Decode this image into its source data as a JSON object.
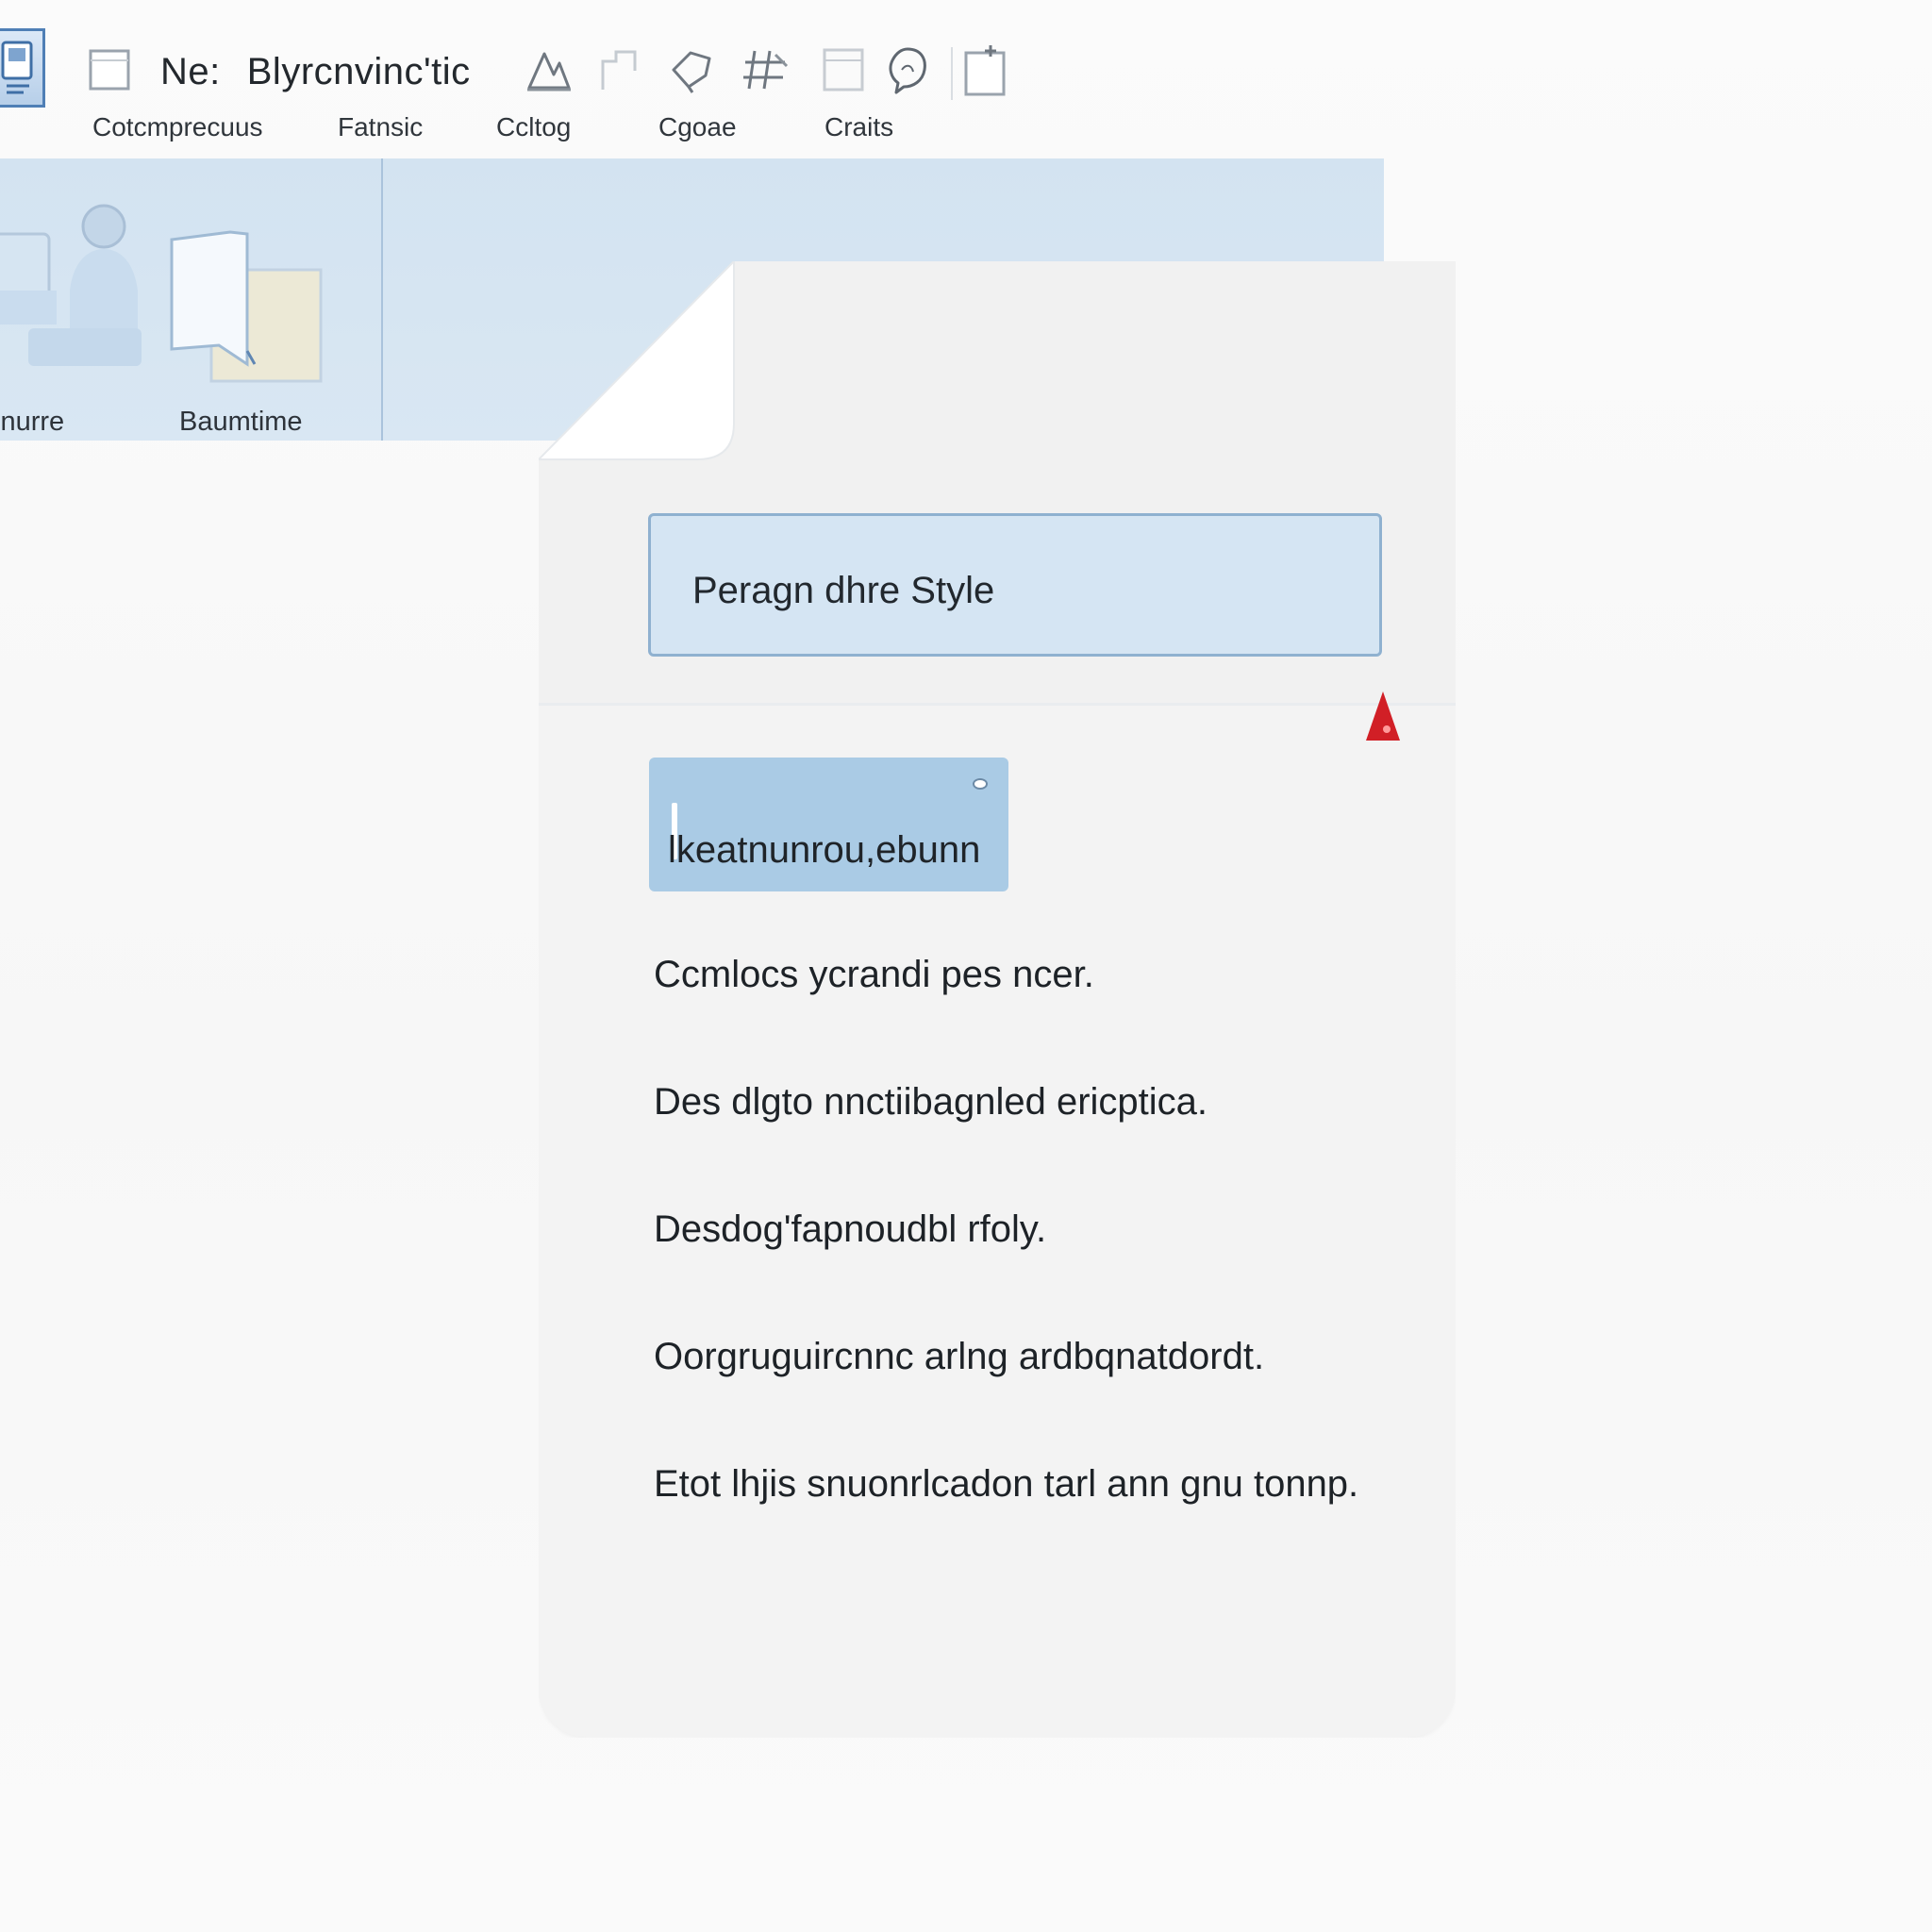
{
  "toolbar": {
    "title_prefix": "Ne:",
    "title": "Blyrcnvinc'tic",
    "icons": [
      "app-icon",
      "page-icon",
      "drawing-tool-icon",
      "shape-icon",
      "lasso-icon",
      "hashtag-icon",
      "table-icon",
      "speech-icon",
      "new-page-icon"
    ]
  },
  "tabs": [
    {
      "label": "Cotcmprecuus"
    },
    {
      "label": "Fatnsic"
    },
    {
      "label": "Ccltog"
    },
    {
      "label": "Cgoae"
    },
    {
      "label": "Craits"
    }
  ],
  "ribbon": {
    "labels": [
      "inurre",
      "Baumtime"
    ],
    "background_color": "#d3e3f1"
  },
  "document": {
    "style_box": {
      "label": "Peragn dhre Style"
    },
    "input_chip": {
      "value": "lkeatnunrou,ebunn"
    },
    "paragraphs": [
      "Ccmlocs ycrandi pes ncer.",
      "Des dlgto nnctiibagnled ericptica.",
      "Desdog'fapnoudbl rfoly.",
      "Oorgruguircnnc arlng ardbqnatdordt.",
      "Etot lhjis snuonrlcadon tarl ann gnu tonnp."
    ],
    "warning_color": "#d11f26",
    "accent_color": "#aacbe5"
  }
}
